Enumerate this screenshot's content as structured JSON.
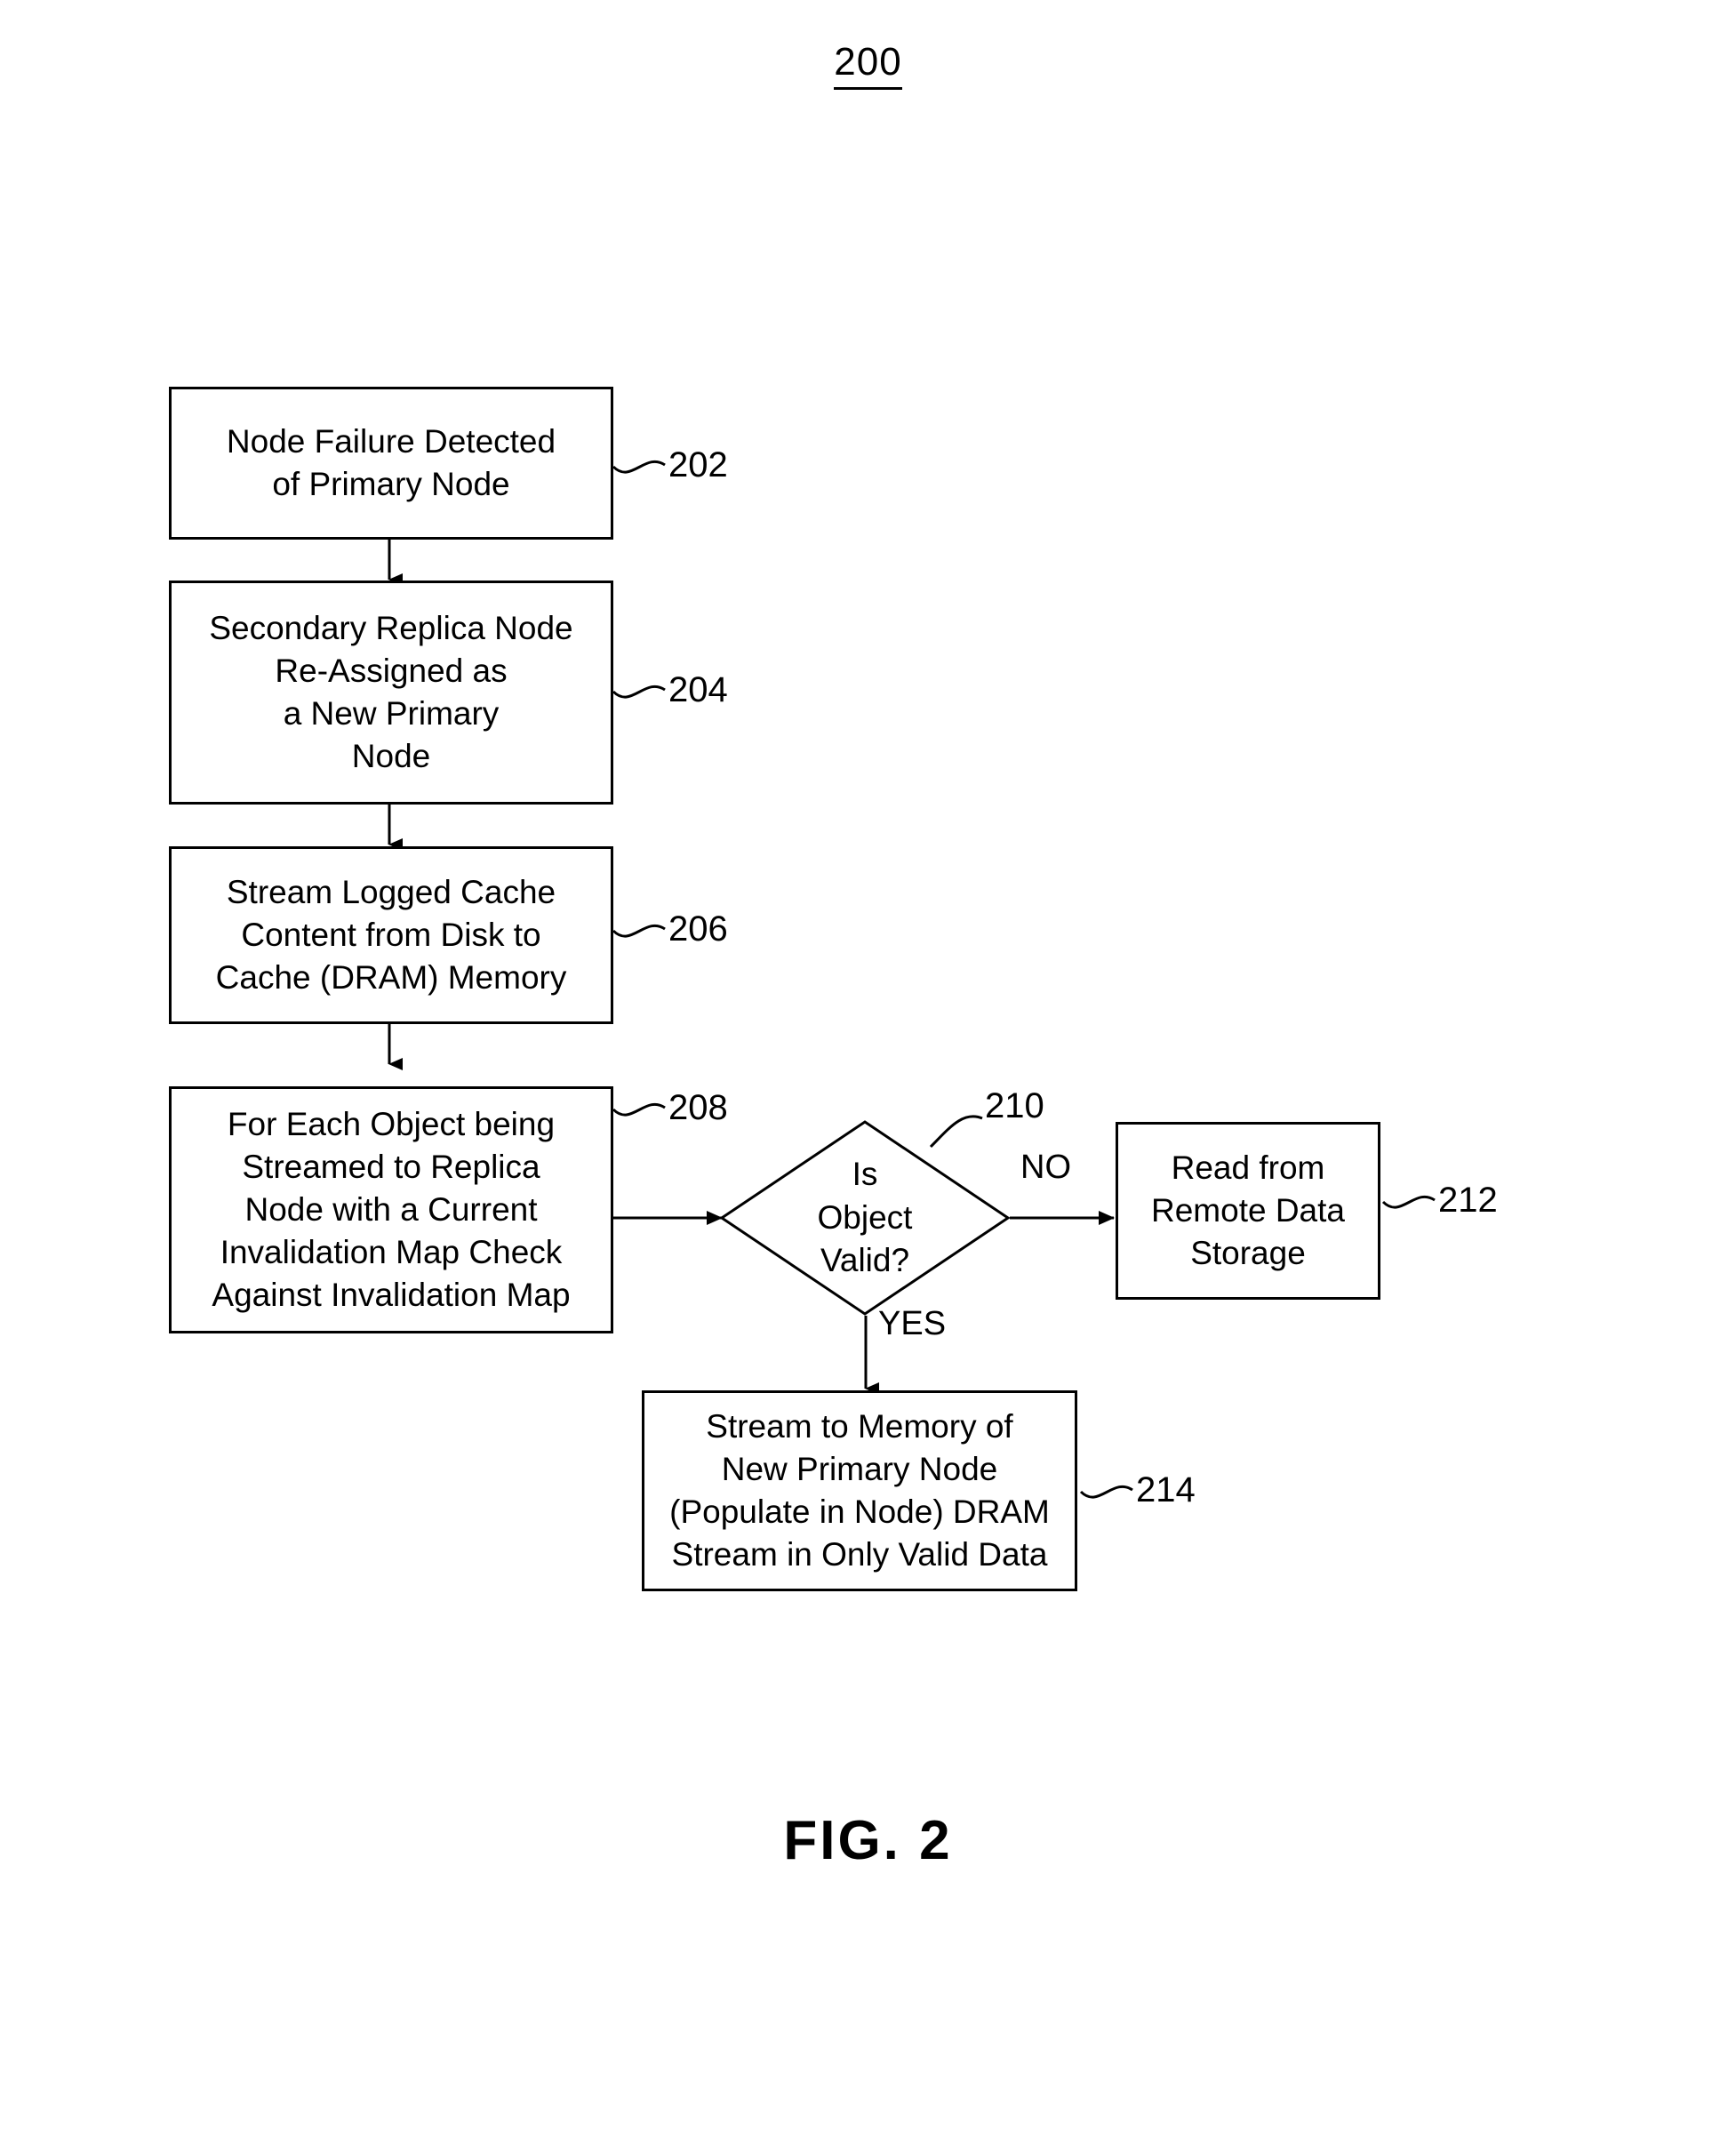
{
  "figure": {
    "top_number": "200",
    "caption": "FIG. 2"
  },
  "nodes": [
    {
      "id": "202",
      "ref": "202",
      "text": "Node Failure Detected\nof Primary Node",
      "shape": "process"
    },
    {
      "id": "204",
      "ref": "204",
      "text": "Secondary Replica Node\nRe-Assigned as\na New Primary\nNode",
      "shape": "process"
    },
    {
      "id": "206",
      "ref": "206",
      "text": "Stream Logged Cache\nContent from Disk to\nCache (DRAM) Memory",
      "shape": "process"
    },
    {
      "id": "208",
      "ref": "208",
      "text": "For Each Object being\nStreamed to Replica\nNode with a Current\nInvalidation Map Check\nAgainst Invalidation Map",
      "shape": "process"
    },
    {
      "id": "210",
      "ref": "210",
      "text": "Is\nObject\nValid?",
      "shape": "decision"
    },
    {
      "id": "212",
      "ref": "212",
      "text": "Read from\nRemote Data\nStorage",
      "shape": "process"
    },
    {
      "id": "214",
      "ref": "214",
      "text": "Stream to Memory of\nNew Primary Node\n(Populate in Node) DRAM\nStream in Only Valid Data",
      "shape": "process"
    }
  ],
  "branches": {
    "no_label": "NO",
    "yes_label": "YES"
  },
  "style": {
    "line_color": "#000000",
    "background": "#ffffff"
  }
}
